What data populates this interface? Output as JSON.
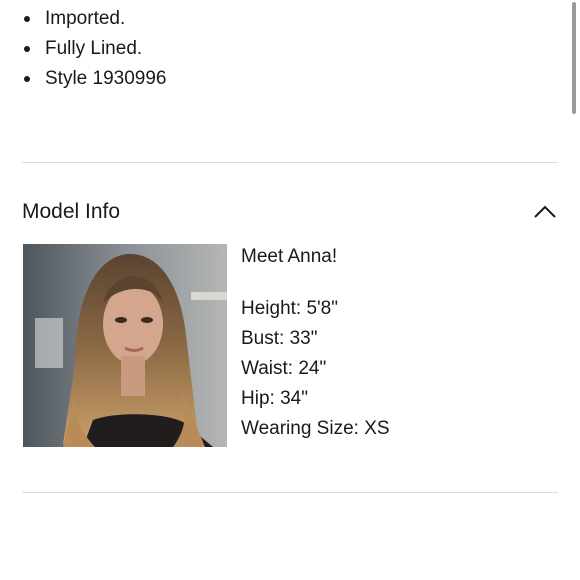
{
  "details": {
    "bullets": [
      "Imported.",
      "Fully Lined.",
      "Style 1930996"
    ]
  },
  "model_info": {
    "title": "Model Info",
    "toggle_icon": "chevron-up-icon",
    "photo_alt": "Anna",
    "greeting": "Meet Anna!",
    "stats": [
      {
        "label": "Height:",
        "value": "5'8\""
      },
      {
        "label": "Bust:",
        "value": "33\""
      },
      {
        "label": "Waist:",
        "value": "24\""
      },
      {
        "label": "Hip:",
        "value": "34\""
      },
      {
        "label": "Wearing Size:",
        "value": "XS"
      }
    ]
  },
  "colors": {
    "text": "#1a1a1a",
    "divider": "#dcdcdc",
    "scrollbar": "#9a9a9a"
  }
}
